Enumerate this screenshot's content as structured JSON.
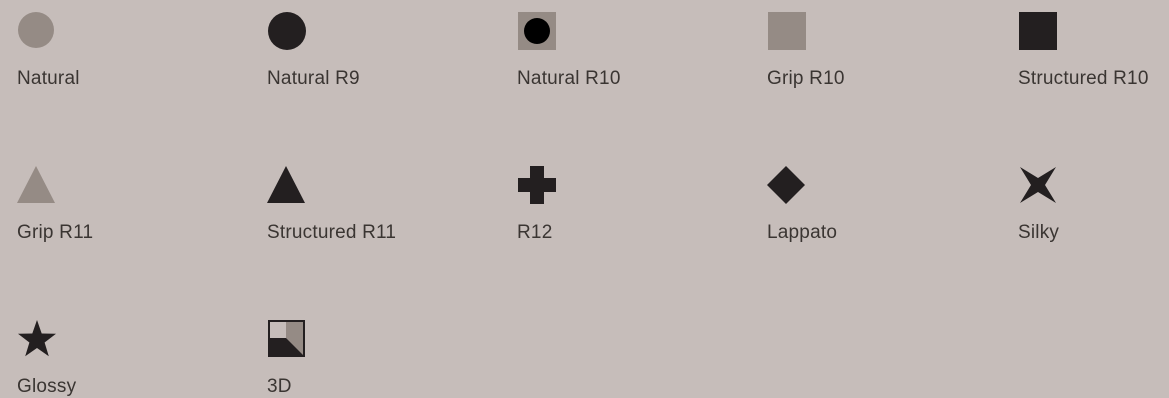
{
  "colors": {
    "background": "#c6bdba",
    "light_icon": "#958b85",
    "dark_icon": "#231f20",
    "text": "#3a3532"
  },
  "finishes": [
    {
      "label": "Natural",
      "icon": "circle-light-icon"
    },
    {
      "label": "Natural R9",
      "icon": "circle-dark-icon"
    },
    {
      "label": "Natural R10",
      "icon": "dot-in-square-icon"
    },
    {
      "label": "Grip R10",
      "icon": "square-light-icon"
    },
    {
      "label": "Structured R10",
      "icon": "square-dark-icon"
    },
    {
      "label": "Grip R11",
      "icon": "triangle-light-icon"
    },
    {
      "label": "Structured R11",
      "icon": "triangle-dark-icon"
    },
    {
      "label": "R12",
      "icon": "cross-icon"
    },
    {
      "label": "Lappato",
      "icon": "diamond-icon"
    },
    {
      "label": "Silky",
      "icon": "four-point-star-icon"
    },
    {
      "label": "Glossy",
      "icon": "star-icon"
    },
    {
      "label": "3D",
      "icon": "3d-square-icon"
    }
  ]
}
